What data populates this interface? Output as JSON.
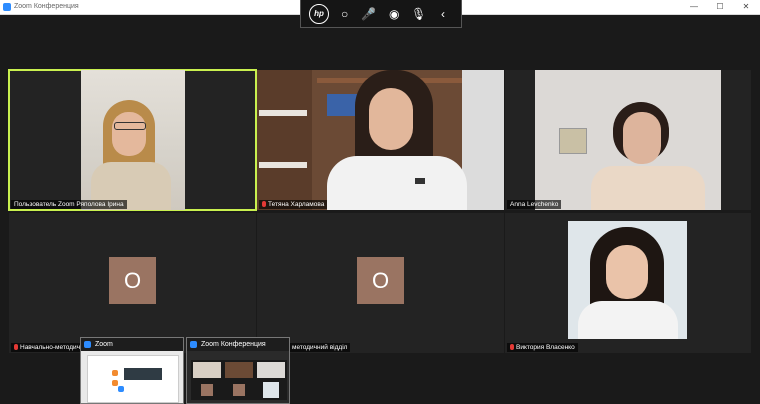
{
  "window": {
    "title": "Zoom Конференция",
    "min": "—",
    "max": "☐",
    "close": "✕"
  },
  "hp_toolbar": {
    "logo": "hp",
    "controls": [
      "○",
      "🎤",
      "◉",
      "🎙",
      "‹"
    ]
  },
  "participants": [
    {
      "name": "Пользователь Zoom Ряполова Ірина",
      "muted": false,
      "active": true
    },
    {
      "name": "Тетяна Харламова",
      "muted": true,
      "active": false
    },
    {
      "name": "Anna Levchenko",
      "muted": false,
      "active": false
    },
    {
      "name": "Навчально-методичний",
      "avatar": "О",
      "muted": true,
      "active": false
    },
    {
      "name": "методичний відділ",
      "avatar": "О",
      "muted": false,
      "active": false
    },
    {
      "name": "Виктория Власенко",
      "muted": true,
      "active": false
    }
  ],
  "taskbar_thumbs": [
    {
      "label": "Zoom"
    },
    {
      "label": "Zoom Конференция"
    }
  ],
  "colors": {
    "active_border": "#c9f04f",
    "avatar_bg": "#9a7462",
    "muted_icon": "#e53935",
    "zoom_blue": "#2d8cff"
  }
}
